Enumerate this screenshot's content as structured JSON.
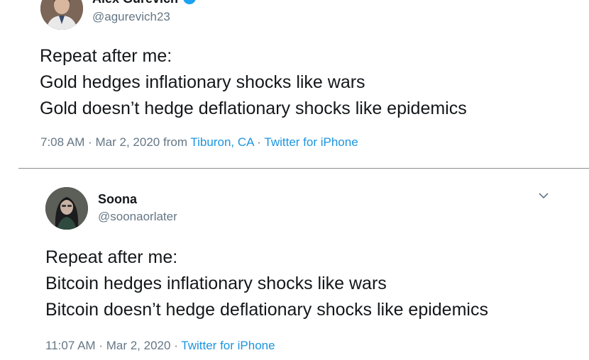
{
  "tweets": [
    {
      "display_name": "Alex Gurevich",
      "verified": true,
      "handle": "@agurevich23",
      "lines": [
        "Repeat after me:",
        "Gold hedges inflationary shocks like wars",
        "Gold doesn’t hedge deflationary shocks like epidemics"
      ],
      "time": "7:08 AM",
      "date": "Mar 2, 2020",
      "from_label": "from",
      "location": "Tiburon, CA",
      "source": "Twitter for iPhone",
      "separator": "·"
    },
    {
      "display_name": "Soona",
      "verified": false,
      "handle": "@soonaorlater",
      "lines": [
        "Repeat after me:",
        "Bitcoin hedges inflationary shocks like wars",
        "Bitcoin doesn’t hedge deflationary shocks like epidemics"
      ],
      "time": "11:07 AM",
      "date": "Mar 2, 2020",
      "source": "Twitter for iPhone",
      "separator": "·"
    }
  ],
  "icons": {
    "verified": "verified-badge-icon",
    "caret": "chevron-down-icon"
  },
  "colors": {
    "link": "#1b95e0",
    "secondary_text": "#657786",
    "verified": "#1da1f2"
  }
}
